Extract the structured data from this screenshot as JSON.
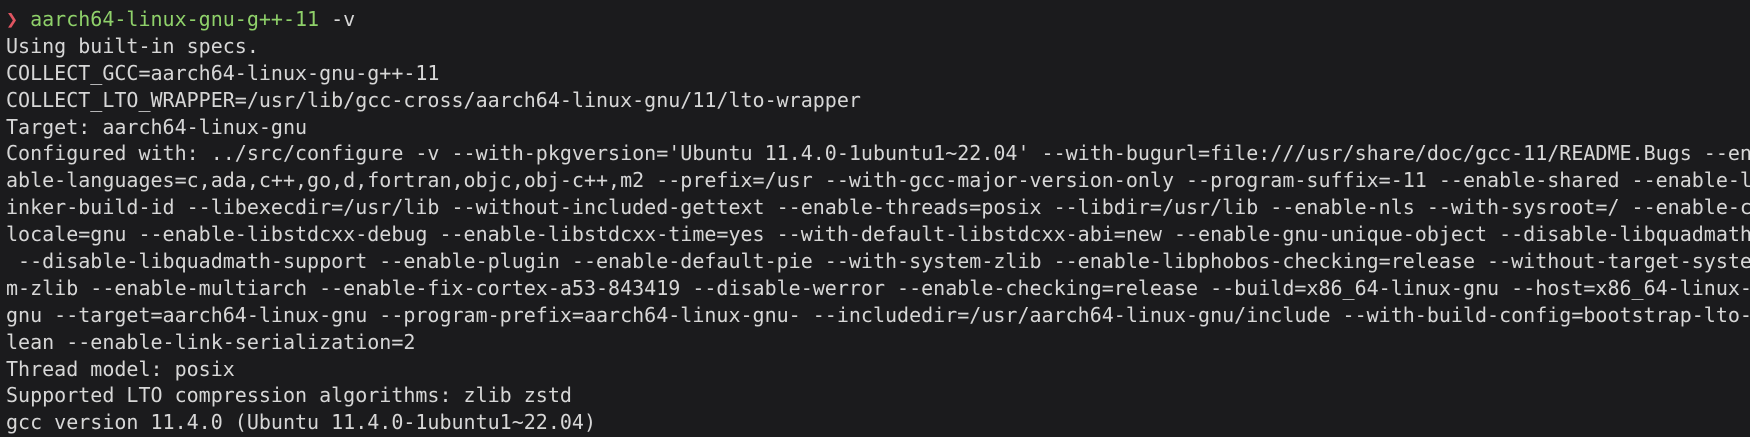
{
  "prompt": {
    "symbol": "❯",
    "command": "aarch64-linux-gnu-g++-11",
    "args": " -v"
  },
  "output": [
    "Using built-in specs.",
    "COLLECT_GCC=aarch64-linux-gnu-g++-11",
    "COLLECT_LTO_WRAPPER=/usr/lib/gcc-cross/aarch64-linux-gnu/11/lto-wrapper",
    "Target: aarch64-linux-gnu",
    "Configured with: ../src/configure -v --with-pkgversion='Ubuntu 11.4.0-1ubuntu1~22.04' --with-bugurl=file:///usr/share/doc/gcc-11/README.Bugs --en",
    "able-languages=c,ada,c++,go,d,fortran,objc,obj-c++,m2 --prefix=/usr --with-gcc-major-version-only --program-suffix=-11 --enable-shared --enable-l",
    "inker-build-id --libexecdir=/usr/lib --without-included-gettext --enable-threads=posix --libdir=/usr/lib --enable-nls --with-sysroot=/ --enable-c",
    "locale=gnu --enable-libstdcxx-debug --enable-libstdcxx-time=yes --with-default-libstdcxx-abi=new --enable-gnu-unique-object --disable-libquadmath",
    " --disable-libquadmath-support --enable-plugin --enable-default-pie --with-system-zlib --enable-libphobos-checking=release --without-target-syste",
    "m-zlib --enable-multiarch --enable-fix-cortex-a53-843419 --disable-werror --enable-checking=release --build=x86_64-linux-gnu --host=x86_64-linux-",
    "gnu --target=aarch64-linux-gnu --program-prefix=aarch64-linux-gnu- --includedir=/usr/aarch64-linux-gnu/include --with-build-config=bootstrap-lto-",
    "lean --enable-link-serialization=2",
    "Thread model: posix",
    "Supported LTO compression algorithms: zlib zstd",
    "gcc version 11.4.0 (Ubuntu 11.4.0-1ubuntu1~22.04)"
  ],
  "colors": {
    "background": "#1b1b1d",
    "text": "#d7d7d7",
    "prompt_symbol": "#e05561",
    "command": "#8fd16a"
  }
}
